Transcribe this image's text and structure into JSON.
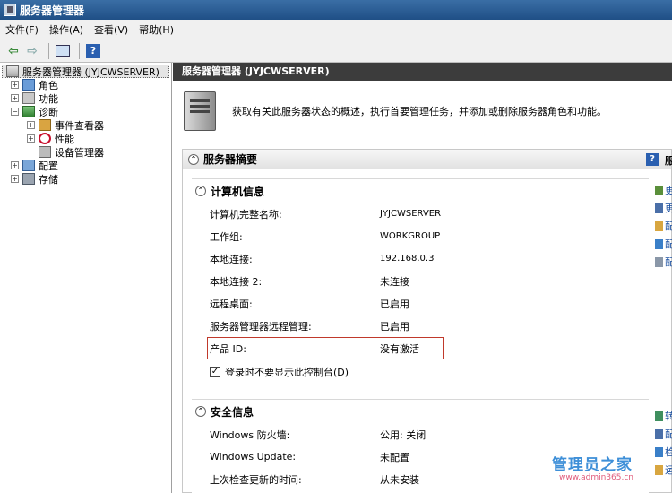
{
  "window": {
    "title": "服务器管理器"
  },
  "menu": [
    "文件(F)",
    "操作(A)",
    "查看(V)",
    "帮助(H)"
  ],
  "toolbar": {
    "icons": [
      "back-arrow-icon",
      "forward-arrow-icon",
      "show-hide-tree-icon",
      "help-icon"
    ]
  },
  "tree": {
    "root": "服务器管理器 (JYJCWSERVER)",
    "items": [
      {
        "label": "角色",
        "icon": "roles-icon",
        "expander": "+"
      },
      {
        "label": "功能",
        "icon": "features-icon",
        "expander": "+"
      },
      {
        "label": "诊断",
        "icon": "diagnostics-icon",
        "expander": "−"
      },
      {
        "label": "事件查看器",
        "icon": "event-viewer-icon",
        "expander": "+"
      },
      {
        "label": "性能",
        "icon": "performance-icon",
        "expander": "+"
      },
      {
        "label": "设备管理器",
        "icon": "device-manager-icon",
        "expander": ""
      },
      {
        "label": "配置",
        "icon": "configuration-icon",
        "expander": "+"
      },
      {
        "label": "存储",
        "icon": "storage-icon",
        "expander": "+"
      }
    ]
  },
  "panel": {
    "header": "服务器管理器 (JYJCWSERVER)",
    "description": "获取有关此服务器状态的概述，执行首要管理任务，并添加或删除服务器角色和功能。",
    "summary_title": "服务器摘要",
    "help_label": "服",
    "computer_info": {
      "title": "计算机信息",
      "rows": [
        {
          "key": "计算机完整名称:",
          "value": "JYJCWSERVER"
        },
        {
          "key": "工作组:",
          "value": "WORKGROUP"
        },
        {
          "key": "本地连接:",
          "value": "192.168.0.3"
        },
        {
          "key": "本地连接 2:",
          "value": "未连接"
        },
        {
          "key": "远程桌面:",
          "value": "已启用"
        },
        {
          "key": "服务器管理器远程管理:",
          "value": "已启用"
        },
        {
          "key": "产品 ID:",
          "value": "没有激活"
        }
      ],
      "checkbox_label": "登录时不要显示此控制台(D)",
      "checkbox_checked": "✓",
      "tasks": [
        "更",
        "更",
        "配",
        "配",
        "配"
      ]
    },
    "security_info": {
      "title": "安全信息",
      "rows": [
        {
          "key": "Windows 防火墙:",
          "value": "公用: 关闭"
        },
        {
          "key": "Windows Update:",
          "value": "未配置"
        },
        {
          "key": "上次检查更新的时间:",
          "value": "从未安装"
        }
      ],
      "tasks": [
        "转",
        "配",
        "检",
        "运"
      ]
    }
  },
  "watermark": {
    "title": "管理员之家",
    "url": "www.admin365.cn"
  },
  "colors": {
    "header_bg": "#3c3c3c",
    "highlight_border": "#c0392b",
    "title_blue": "#1f4f86"
  }
}
